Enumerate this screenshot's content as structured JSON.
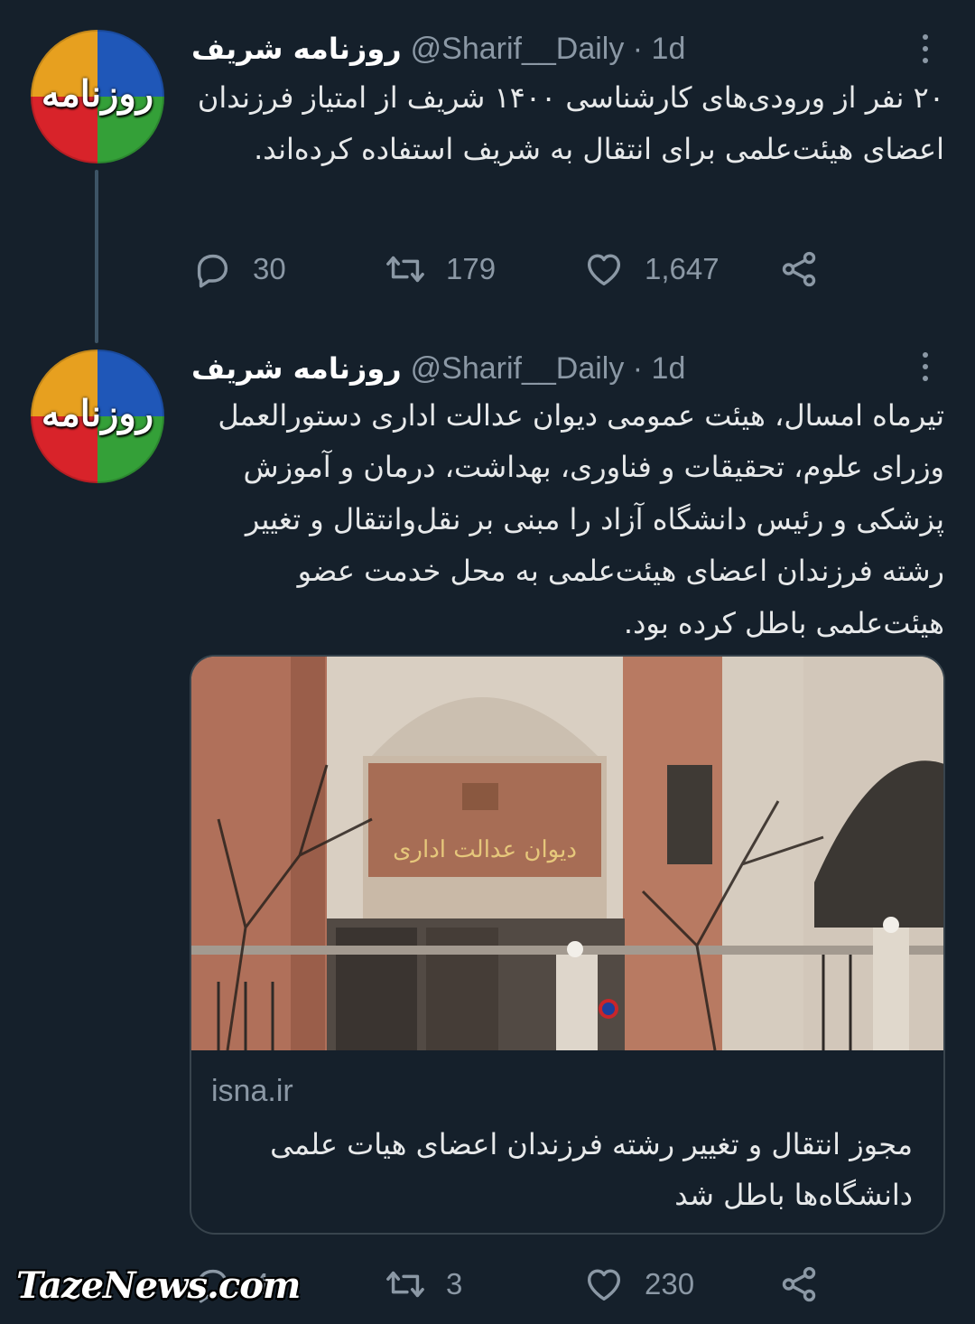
{
  "tweets": [
    {
      "avatar_text": "روزنامه",
      "name": "روزنامه شریف",
      "handle": "@Sharif__Daily · 1d",
      "text": "۲۰ نفر از ورودی‌های کارشناسی ۱۴۰۰ شریف از امتیاز فرزندان اعضای هیئت‌علمی برای انتقال به شریف استفاده کرده‌اند.",
      "replies": "30",
      "retweets": "179",
      "likes": "1,647"
    },
    {
      "avatar_text": "روزنامه",
      "name": "روزنامه شریف",
      "handle": "@Sharif__Daily · 1d",
      "text": "تیرماه امسال، هیئت عمومی دیوان عدالت اداری دستورالعمل وزرای علوم، تحقیقات و فناوری، بهداشت، درمان و آموزش پزشکی و رئیس دانشگاه آزاد را مبنی بر نقل‌وانتقال و تغییر رشته فرزندان اعضای هیئت‌علمی به محل خدمت عضو هیئت‌علمی باطل  کرده بود.",
      "card": {
        "domain": "isna.ir",
        "title": "مجوز انتقال و تغییر رشته فرزندان اعضای هیات علمی دانشگاه‌ها باطل شد",
        "image_sign_text": "دیوان عدالت اداری"
      },
      "replies": "4",
      "retweets": "3",
      "likes": "230"
    }
  ],
  "watermark": "TazeNews.com",
  "icons": {
    "reply": "reply-icon",
    "retweet": "retweet-icon",
    "like": "heart-icon",
    "share": "share-icon",
    "more": "more-vertical-icon"
  },
  "colors": {
    "background": "#15202b",
    "primary_text": "#e7e9ea",
    "secondary_text": "#8b98a5",
    "border": "#38444d"
  }
}
